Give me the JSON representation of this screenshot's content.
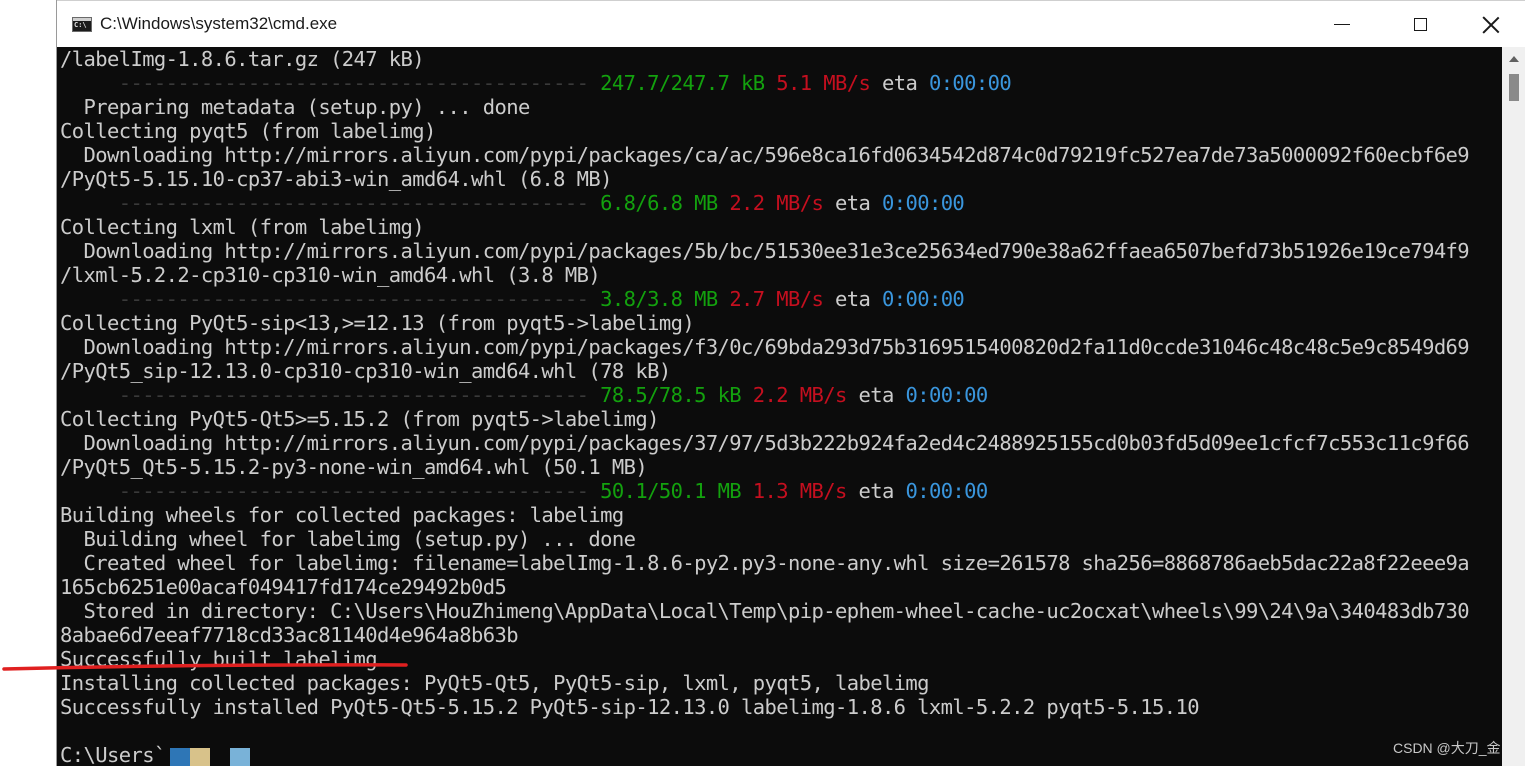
{
  "window": {
    "title": "C:\\Windows\\system32\\cmd.exe"
  },
  "console": {
    "lines": [
      [
        {
          "t": "/labelImg-1.8.6.tar.gz (247 kB)",
          "c": "c-gray"
        }
      ],
      [
        {
          "t": "     ----------------------------------------",
          "c": "c-bar"
        },
        {
          "t": " 247.7/247.7 kB",
          "c": "c-green"
        },
        {
          "t": " 5.1 MB/s",
          "c": "c-red"
        },
        {
          "t": " eta ",
          "c": "c-gray"
        },
        {
          "t": "0:00:00",
          "c": "c-cyan"
        }
      ],
      [
        {
          "t": "  Preparing metadata (setup.py) ... done",
          "c": "c-gray"
        }
      ],
      [
        {
          "t": "Collecting pyqt5 (from labelimg)",
          "c": "c-gray"
        }
      ],
      [
        {
          "t": "  Downloading http://mirrors.aliyun.com/pypi/packages/ca/ac/596e8ca16fd0634542d874c0d79219fc527ea7de73a5000092f60ecbf6e9",
          "c": "c-gray"
        }
      ],
      [
        {
          "t": "/PyQt5-5.15.10-cp37-abi3-win_amd64.whl (6.8 MB)",
          "c": "c-gray"
        }
      ],
      [
        {
          "t": "     ----------------------------------------",
          "c": "c-bar"
        },
        {
          "t": " 6.8/6.8 MB",
          "c": "c-green"
        },
        {
          "t": " 2.2 MB/s",
          "c": "c-red"
        },
        {
          "t": " eta ",
          "c": "c-gray"
        },
        {
          "t": "0:00:00",
          "c": "c-cyan"
        }
      ],
      [
        {
          "t": "Collecting lxml (from labelimg)",
          "c": "c-gray"
        }
      ],
      [
        {
          "t": "  Downloading http://mirrors.aliyun.com/pypi/packages/5b/bc/51530ee31e3ce25634ed790e38a62ffaea6507befd73b51926e19ce794f9",
          "c": "c-gray"
        }
      ],
      [
        {
          "t": "/lxml-5.2.2-cp310-cp310-win_amd64.whl (3.8 MB)",
          "c": "c-gray"
        }
      ],
      [
        {
          "t": "     ----------------------------------------",
          "c": "c-bar"
        },
        {
          "t": " 3.8/3.8 MB",
          "c": "c-green"
        },
        {
          "t": " 2.7 MB/s",
          "c": "c-red"
        },
        {
          "t": " eta ",
          "c": "c-gray"
        },
        {
          "t": "0:00:00",
          "c": "c-cyan"
        }
      ],
      [
        {
          "t": "Collecting PyQt5-sip<13,>=12.13 (from pyqt5->labelimg)",
          "c": "c-gray"
        }
      ],
      [
        {
          "t": "  Downloading http://mirrors.aliyun.com/pypi/packages/f3/0c/69bda293d75b3169515400820d2fa11d0ccde31046c48c48c5e9c8549d69",
          "c": "c-gray"
        }
      ],
      [
        {
          "t": "/PyQt5_sip-12.13.0-cp310-cp310-win_amd64.whl (78 kB)",
          "c": "c-gray"
        }
      ],
      [
        {
          "t": "     ----------------------------------------",
          "c": "c-bar"
        },
        {
          "t": " 78.5/78.5 kB",
          "c": "c-green"
        },
        {
          "t": " 2.2 MB/s",
          "c": "c-red"
        },
        {
          "t": " eta ",
          "c": "c-gray"
        },
        {
          "t": "0:00:00",
          "c": "c-cyan"
        }
      ],
      [
        {
          "t": "Collecting PyQt5-Qt5>=5.15.2 (from pyqt5->labelimg)",
          "c": "c-gray"
        }
      ],
      [
        {
          "t": "  Downloading http://mirrors.aliyun.com/pypi/packages/37/97/5d3b222b924fa2ed4c2488925155cd0b03fd5d09ee1cfcf7c553c11c9f66",
          "c": "c-gray"
        }
      ],
      [
        {
          "t": "/PyQt5_Qt5-5.15.2-py3-none-win_amd64.whl (50.1 MB)",
          "c": "c-gray"
        }
      ],
      [
        {
          "t": "     ----------------------------------------",
          "c": "c-bar"
        },
        {
          "t": " 50.1/50.1 MB",
          "c": "c-green"
        },
        {
          "t": " 1.3 MB/s",
          "c": "c-red"
        },
        {
          "t": " eta ",
          "c": "c-gray"
        },
        {
          "t": "0:00:00",
          "c": "c-cyan"
        }
      ],
      [
        {
          "t": "Building wheels for collected packages: labelimg",
          "c": "c-gray"
        }
      ],
      [
        {
          "t": "  Building wheel for labelimg (setup.py) ... done",
          "c": "c-gray"
        }
      ],
      [
        {
          "t": "  Created wheel for labelimg: filename=labelImg-1.8.6-py2.py3-none-any.whl size=261578 sha256=8868786aeb5dac22a8f22eee9a",
          "c": "c-gray"
        }
      ],
      [
        {
          "t": "165cb6251e00acaf049417fd174ce29492b0d5",
          "c": "c-gray"
        }
      ],
      [
        {
          "t": "  Stored in directory: C:\\Users\\HouZhimeng\\AppData\\Local\\Temp\\pip-ephem-wheel-cache-uc2ocxat\\wheels\\99\\24\\9a\\340483db730",
          "c": "c-gray"
        }
      ],
      [
        {
          "t": "8abae6d7eeaf7718cd33ac81140d4e964a8b63b",
          "c": "c-gray"
        }
      ],
      [
        {
          "t": "Successfully built labelimg",
          "c": "c-gray"
        }
      ],
      [
        {
          "t": "Installing collected packages: PyQt5-Qt5, PyQt5-sip, lxml, pyqt5, labelimg",
          "c": "c-gray"
        }
      ],
      [
        {
          "t": "Successfully installed PyQt5-Qt5-5.15.2 PyQt5-sip-12.13.0 labelimg-1.8.6 lxml-5.2.2 pyqt5-5.15.10",
          "c": "c-gray"
        }
      ],
      [
        {
          "t": "",
          "c": "c-gray"
        }
      ],
      [
        {
          "t": "C:\\Users`",
          "c": "c-gray"
        }
      ]
    ]
  },
  "colors": {
    "background": "#0c0c0c",
    "text": "#cccccc",
    "progress": "#13a10e",
    "speed": "#c50f1f",
    "eta": "#3a96dd",
    "annotation": "#e02020"
  },
  "icons": {
    "app": "cmd-icon",
    "minimize": "minimize-icon",
    "maximize": "maximize-icon",
    "close": "close-icon"
  },
  "watermark": "CSDN @大刀_金"
}
